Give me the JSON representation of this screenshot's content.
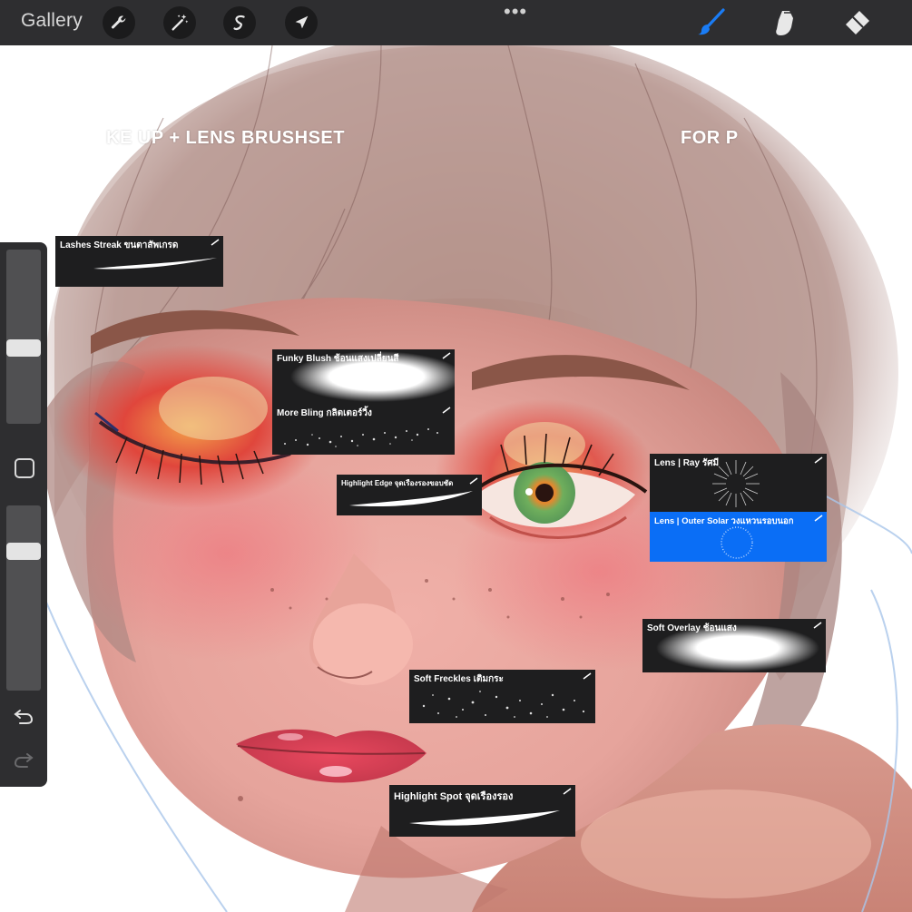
{
  "toolbar": {
    "gallery_label": "Gallery",
    "more_label": "•••",
    "left_tools": [
      "wrench-icon",
      "magic-wand-icon",
      "selection-icon",
      "transform-arrow-icon"
    ],
    "right_tools": [
      "brush-icon",
      "smudge-icon",
      "eraser-icon"
    ],
    "active_tool": "brush",
    "accent_color": "#1a7cf5"
  },
  "canvas": {
    "headline_left": "KE UP + LENS BRUSHSET",
    "headline_right": "FOR P"
  },
  "brushes": [
    {
      "name": "Lashes Streak ขนตาสัพเกรด"
    },
    {
      "name": "Funky Blush ช้อนแสงเปลี่ยนสี"
    },
    {
      "name": "More Bling กลิตเตอร์วิ้ง"
    },
    {
      "name": "Highlight Edge จุดเรืองรองขอบชัด"
    },
    {
      "name": "Lens | Ray รัศมี"
    },
    {
      "name": "Lens | Outer Solar วงแหวนรอบนอก",
      "selected": true
    },
    {
      "name": "Soft Overlay ช้อนแสง"
    },
    {
      "name": "Soft Freckles เติมกระ"
    },
    {
      "name": "Highlight Spot จุดเรืองรอง"
    }
  ],
  "sidebar": {
    "size_slider_level": 0.43,
    "opacity_slider_level": 0.78,
    "icons": [
      "modify-square-icon",
      "undo-icon",
      "redo-icon"
    ]
  }
}
